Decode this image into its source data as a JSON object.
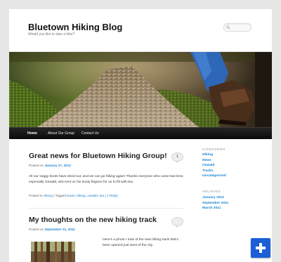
{
  "site": {
    "title": "Bluetown Hiking Blog",
    "description": "Would you like to take a hike?"
  },
  "search": {
    "placeholder": ""
  },
  "nav": {
    "items": [
      {
        "label": "Home"
      },
      {
        "label": "About Our Group"
      },
      {
        "label": "Contact Us"
      }
    ]
  },
  "posts": [
    {
      "title": "Great news for Bluetown Hiking Group!",
      "posted_on": "Posted on",
      "date": "January 27, 2012",
      "comment_count": "1",
      "excerpt": "All our soggy boots have dried out, and we can go hiking again! Thanks everyone who came last time, especially Oswald, who lent us his trusty flagons for us to fill with tea.",
      "meta_posted_in": "Posted in",
      "category": "Hiking",
      "meta_tagged": "| Tagged",
      "tags": [
        "boots",
        "hiking",
        "oswald",
        "tea"
      ],
      "reply_sep": "|",
      "reply": "1 Reply"
    },
    {
      "title": "My thoughts on the new hiking track",
      "posted_on": "Posted on",
      "date": "September 21, 2011",
      "comment_count": "",
      "excerpt": "Here's a photo I took of the new hiking track that's been opened just west of the city."
    }
  ],
  "sidebar": {
    "categories_title": "CATEGORIES",
    "categories": [
      "Hiking",
      "News",
      "Oswald",
      "Tracks",
      "Uncategorized"
    ],
    "archives_title": "ARCHIVES",
    "archives": [
      "January 2012",
      "September 2011",
      "March 2011"
    ]
  },
  "fab": {
    "icon": "plus-icon"
  },
  "colors": {
    "link": "#1982d1",
    "nav_bg": "#111111",
    "fab": "#1b5fd6"
  }
}
